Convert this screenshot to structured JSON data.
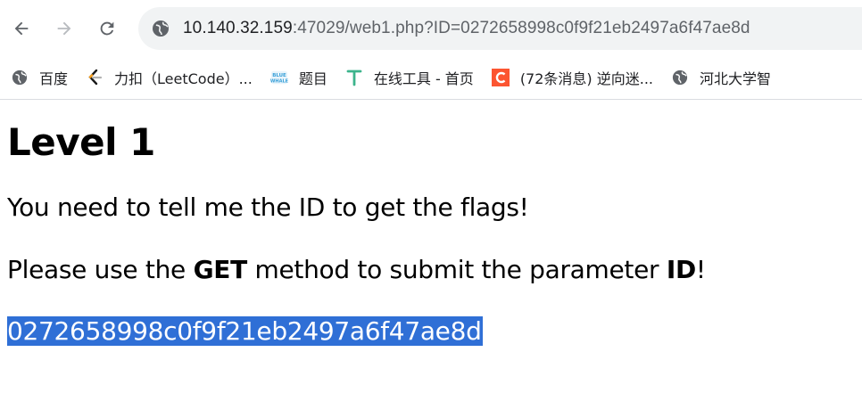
{
  "browser": {
    "url_host": "10.140.32.159",
    "url_rest": ":47029/web1.php?ID=0272658998c0f9f21eb2497a6f47ae8d"
  },
  "bookmarks": [
    {
      "label": "百度",
      "icon": "globe-icon"
    },
    {
      "label": "力扣（LeetCode）...",
      "icon": "leetcode-icon"
    },
    {
      "label": "题目",
      "icon": "bluewhale-icon"
    },
    {
      "label": "在线工具 - 首页",
      "icon": "tool-t-icon"
    },
    {
      "label": "(72条消息) 逆向迷...",
      "icon": "csdn-c-icon"
    },
    {
      "label": "河北大学智",
      "icon": "globe-icon"
    }
  ],
  "page": {
    "heading": "Level 1",
    "line1": "You need to tell me the ID to get the flags!",
    "line2_pre": "Please use the ",
    "line2_get": "GET",
    "line2_mid": " method to submit the parameter ",
    "line2_id": "ID",
    "line2_post": "!",
    "selected_id": "0272658998c0f9f21eb2497a6f47ae8d"
  },
  "colors": {
    "selection": "#2f6fd6",
    "omnibox": "#f1f3f4"
  }
}
